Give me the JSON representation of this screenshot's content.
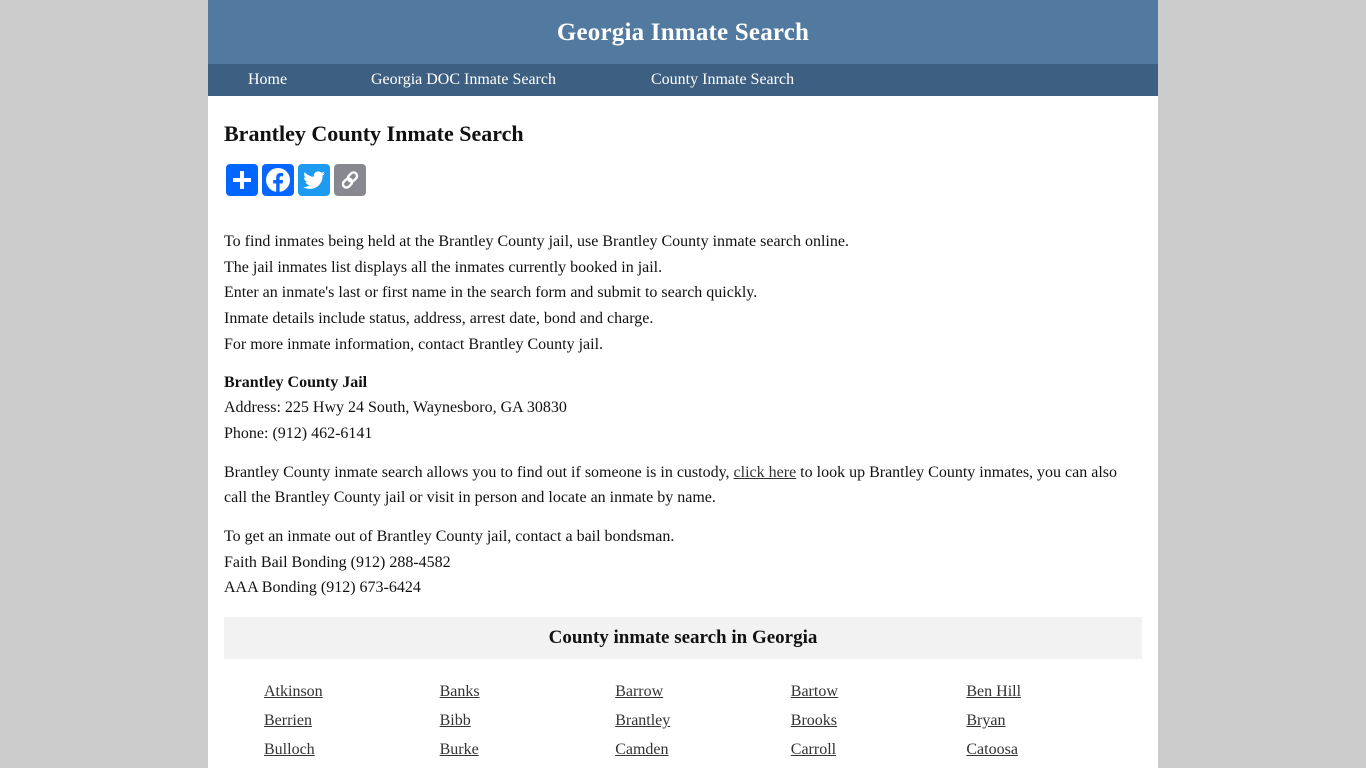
{
  "header": {
    "site_title": "Georgia Inmate Search"
  },
  "nav": {
    "items": [
      {
        "label": "Home"
      },
      {
        "label": "Georgia DOC Inmate Search"
      },
      {
        "label": "County Inmate Search"
      }
    ]
  },
  "main": {
    "title": "Brantley County Inmate Search",
    "share_buttons": [
      {
        "icon": "plus-share-icon",
        "label": "Share",
        "color": "#0166ff"
      },
      {
        "icon": "facebook-icon",
        "label": "Facebook",
        "color": "#0866ff"
      },
      {
        "icon": "twitter-icon",
        "label": "Twitter",
        "color": "#1d9bf0"
      },
      {
        "icon": "copy-link-icon",
        "label": "Copy Link",
        "color": "#888990"
      }
    ],
    "intro_lines": [
      "To find inmates being held at the Brantley County jail, use Brantley County inmate search online.",
      "The jail inmates list displays all the inmates currently booked in jail.",
      "Enter an inmate's last or first name in the search form and submit to search quickly.",
      "Inmate details include status, address, arrest date, bond and charge.",
      "For more inmate information, contact Brantley County jail."
    ],
    "jail": {
      "name": "Brantley County Jail",
      "address": "Address: 225 Hwy 24 South, Waynesboro, GA 30830",
      "phone": "Phone: (912) 462-6141"
    },
    "custody": {
      "before_link": "Brantley County inmate search allows you to find out if someone is in custody, ",
      "link_text": "click here",
      "after_link": " to look up Brantley County inmates, you can also call the Brantley County jail or visit in person and locate an inmate by name."
    },
    "bail_lines": [
      "To get an inmate out of Brantley County jail, contact a bail bondsman.",
      "Faith Bail Bonding (912) 288-4582",
      "AAA Bonding (912) 673-6424"
    ],
    "counties": {
      "title": "County inmate search in Georgia",
      "items": [
        "Atkinson",
        "Banks",
        "Barrow",
        "Bartow",
        "Ben Hill",
        "Berrien",
        "Bibb",
        "Brantley",
        "Brooks",
        "Bryan",
        "Bulloch",
        "Burke",
        "Camden",
        "Carroll",
        "Catoosa"
      ]
    }
  }
}
